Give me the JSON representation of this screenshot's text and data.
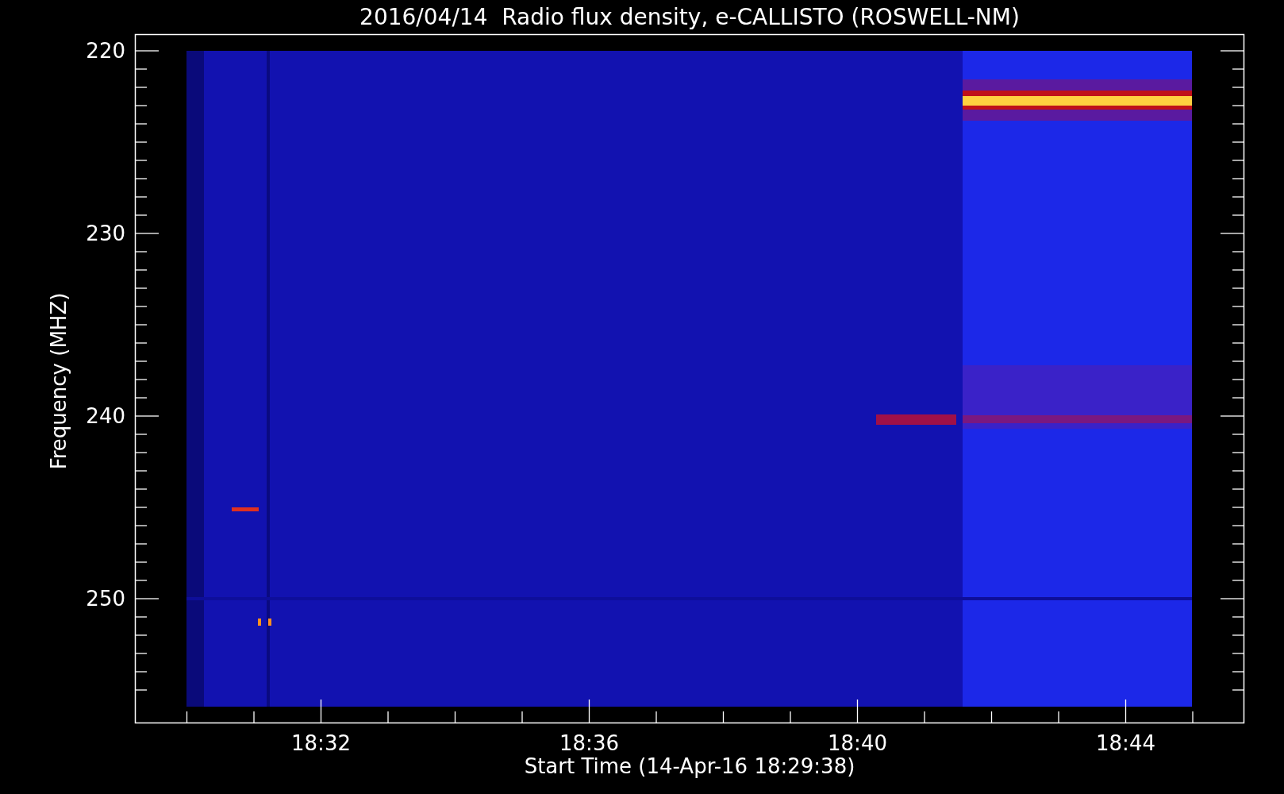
{
  "title": "2016/04/14  Radio flux density, e-CALLISTO (ROSWELL-NM)",
  "y_axis": {
    "label": "Frequency (MHZ)",
    "ticks": [
      "220",
      "230",
      "240",
      "250"
    ]
  },
  "x_axis": {
    "label": "Start Time (14-Apr-16 18:29:38)",
    "ticks": [
      "18:32",
      "18:36",
      "18:40",
      "18:44"
    ]
  }
}
